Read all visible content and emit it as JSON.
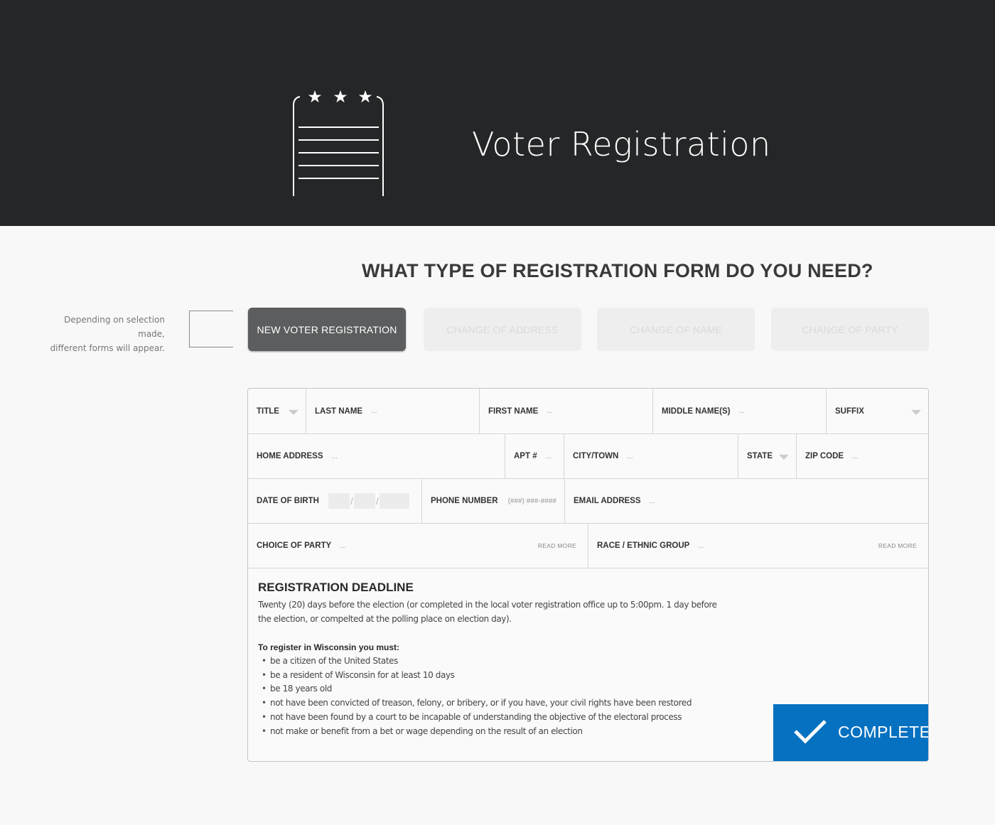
{
  "header": {
    "title": "Voter Registration",
    "logo_icon": "ballot-stars-icon"
  },
  "question": "WHAT TYPE OF REGISTRATION FORM DO YOU NEED?",
  "hint": {
    "line1": "Depending on selection made,",
    "line2": "different forms will appear."
  },
  "form_types": [
    {
      "label": "NEW VOTER REGISTRATION",
      "selected": true
    },
    {
      "label": "CHANGE OF ADDRESS",
      "selected": false
    },
    {
      "label": "CHANGE OF NAME",
      "selected": false
    },
    {
      "label": "CHANGE OF PARTY",
      "selected": false
    }
  ],
  "fields": {
    "title": {
      "label": "TITLE"
    },
    "last_name": {
      "label": "LAST NAME",
      "placeholder": "..."
    },
    "first_name": {
      "label": "FIRST NAME",
      "placeholder": "..."
    },
    "middle_name": {
      "label": "MIDDLE NAME(S)",
      "placeholder": "..."
    },
    "suffix": {
      "label": "SUFFIX"
    },
    "home_address": {
      "label": "HOME ADDRESS",
      "placeholder": "..."
    },
    "apt": {
      "label": "APT #",
      "placeholder": "..."
    },
    "city": {
      "label": "CITY/TOWN",
      "placeholder": "..."
    },
    "state": {
      "label": "STATE"
    },
    "zip": {
      "label": "ZIP CODE",
      "placeholder": "..."
    },
    "dob": {
      "label": "DATE OF BIRTH",
      "separator": "/"
    },
    "phone": {
      "label": "PHONE NUMBER",
      "placeholder": "(###) ###-####"
    },
    "email": {
      "label": "EMAIL ADDRESS",
      "placeholder": "..."
    },
    "party": {
      "label": "CHOICE OF PARTY",
      "placeholder": "...",
      "read_more": "READ MORE"
    },
    "race": {
      "label": "RACE / ETHNIC GROUP",
      "placeholder": "...",
      "read_more": "READ MORE"
    }
  },
  "deadline": {
    "title": "REGISTRATION DEADLINE",
    "text": "Twenty (20) days before the election (or completed in the local voter registration office up to 5:00pm. 1 day before the election, or compelted at the polling place on election day).",
    "must_title": "To register in Wisconsin you must:",
    "requirements": [
      "be a citizen of the United States",
      "be a resident of Wisconsin for at least 10 days",
      "be 18 years old",
      "not have been convicted of treason, felony, or bribery, or if you have, your civil rights have been restored",
      "not have been found by a court to be incapable of understanding the objective of the electoral process",
      "not make or benefit from a bet or wage depending on the result of an election"
    ]
  },
  "complete_button": {
    "label": "COMPLETE",
    "icon": "checkmark-icon",
    "color": "#0571c0"
  }
}
